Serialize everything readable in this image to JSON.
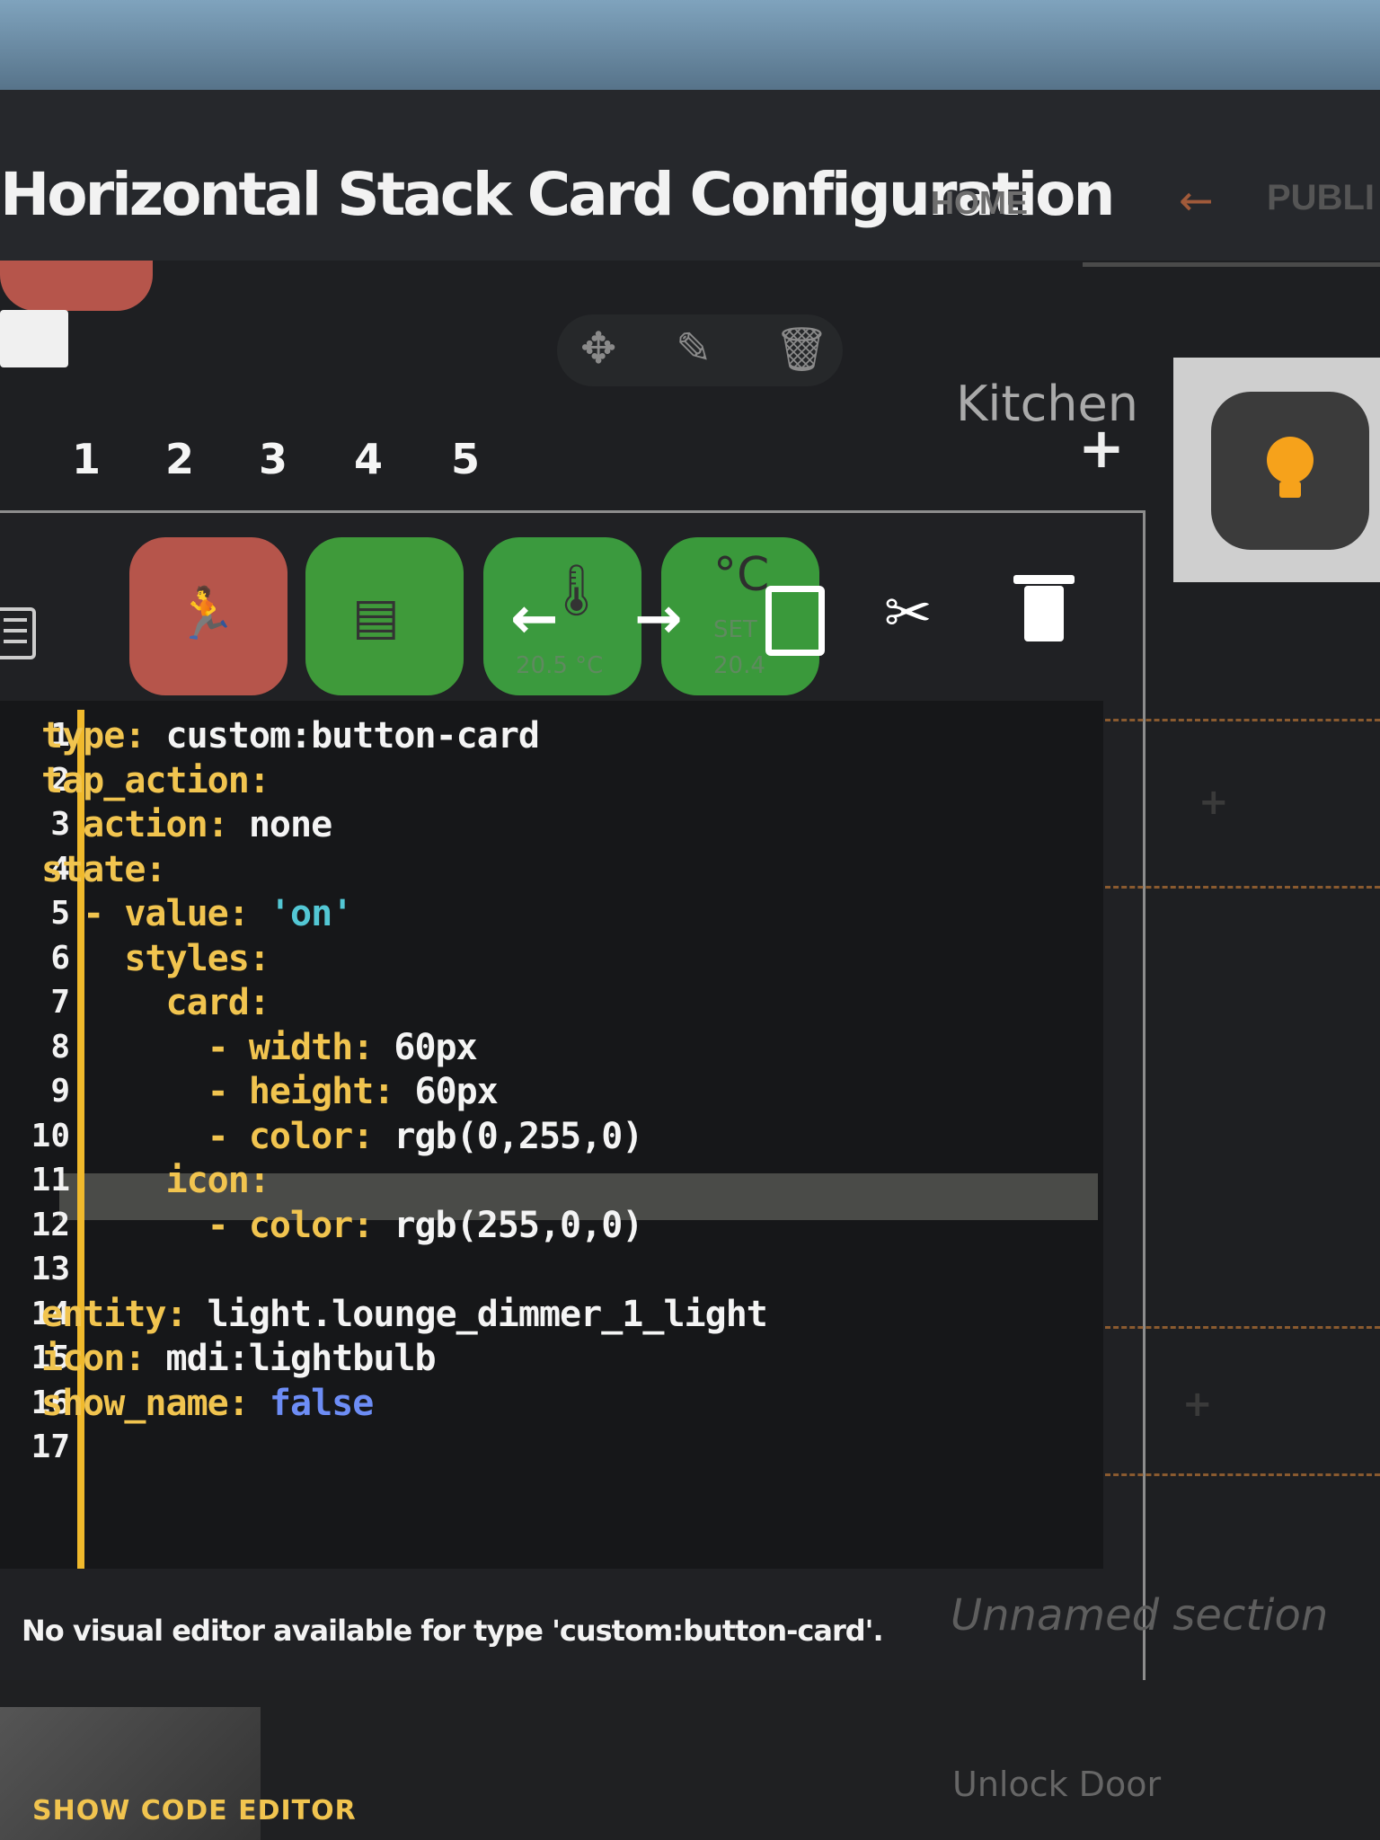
{
  "dialog": {
    "title": "Horizontal Stack Card Configuration",
    "no_visual_editor_msg": "No visual editor available for type 'custom:button-card'.",
    "show_code_editor": "SHOW CODE EDITOR"
  },
  "header": {
    "home_tab": "HOME",
    "public_tab": "PUBLI"
  },
  "steps": [
    "1",
    "2",
    "3",
    "4",
    "5"
  ],
  "card_previews": [
    {
      "icon": "motion-sensor-icon",
      "color": "#b6554b",
      "value": ""
    },
    {
      "icon": "couch-icon",
      "color": "#3f9a3a",
      "value": ""
    },
    {
      "icon": "thermometer-icon",
      "color": "#3b9a3e",
      "value": "20.5 °C"
    },
    {
      "icon": "thermostat-icon",
      "color": "#3a993b",
      "value": "20.4",
      "sublabel": "SET",
      "unit": "°C"
    }
  ],
  "code_editor": {
    "lines": [
      {
        "num": "1",
        "key": "type:",
        "val": " custom:button-card"
      },
      {
        "num": "2",
        "key": "tap_action:",
        "val": ""
      },
      {
        "num": "3",
        "key": "  action:",
        "val": " none"
      },
      {
        "num": "4",
        "key": "state:",
        "val": ""
      },
      {
        "num": "5",
        "key": "  - value:",
        "val": " 'on'"
      },
      {
        "num": "6",
        "key": "    styles:",
        "val": ""
      },
      {
        "num": "7",
        "key": "      card:",
        "val": ""
      },
      {
        "num": "8",
        "key": "        - width:",
        "val": " 60px"
      },
      {
        "num": "9",
        "key": "        - height:",
        "val": " 60px"
      },
      {
        "num": "10",
        "key": "        - color:",
        "val": " rgb(0,255,0)"
      },
      {
        "num": "11",
        "key": "      icon:",
        "val": ""
      },
      {
        "num": "12",
        "key": "        - color:",
        "val": " rgb(255,0,0)"
      },
      {
        "num": "13",
        "key": "",
        "val": ""
      },
      {
        "num": "14",
        "key": "entity:",
        "val": " light.lounge_dimmer_1_light"
      },
      {
        "num": "15",
        "key": "icon:",
        "val": " mdi:lightbulb"
      },
      {
        "num": "16",
        "key": "show_name:",
        "val": " false"
      },
      {
        "num": "17",
        "key": "",
        "val": ""
      }
    ]
  },
  "background": {
    "kitchen_label": "Kitchen",
    "unnamed_section": "Unnamed section",
    "unlock_door": "Unlock Door"
  },
  "colors": {
    "accent": "#f1c44f",
    "red_card": "#b6554b",
    "green_card": "#3f9a3a",
    "bulb": "#f6a21b"
  }
}
